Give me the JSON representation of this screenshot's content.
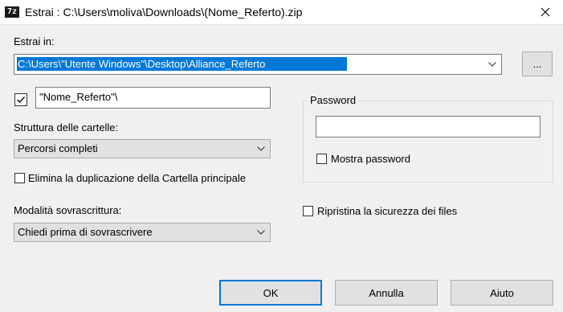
{
  "window": {
    "app_icon_text": "7z",
    "title": "Estrai : C:\\Users\\moliva\\Downloads\\(Nome_Referto).zip"
  },
  "extract_to": {
    "label": "Estrai in:",
    "path": "C:\\Users\\\"Utente Windows\"\\Desktop\\Alliance_Referto",
    "browse_label": "..."
  },
  "subfolder": {
    "checked": true,
    "value": "\"Nome_Referto\"\\"
  },
  "folder_structure": {
    "label": "Struttura delle cartelle:",
    "selected": "Percorsi completi"
  },
  "eliminate_duplication": {
    "label": "Elimina la duplicazione della Cartella principale",
    "checked": false
  },
  "overwrite_mode": {
    "label": "Modalità sovrascrittura:",
    "selected": "Chiedi prima di sovrascrivere"
  },
  "password": {
    "group_label": "Password",
    "value": "",
    "show_label": "Mostra password",
    "show_checked": false
  },
  "restore_security": {
    "label": "Ripristina la sicurezza dei files",
    "checked": false
  },
  "buttons": {
    "ok": "OK",
    "cancel": "Annulla",
    "help": "Aiuto"
  },
  "colors": {
    "selection": "#0078d7",
    "dialog_bg": "#f0f0f0",
    "default_button_border": "#0078d7"
  }
}
